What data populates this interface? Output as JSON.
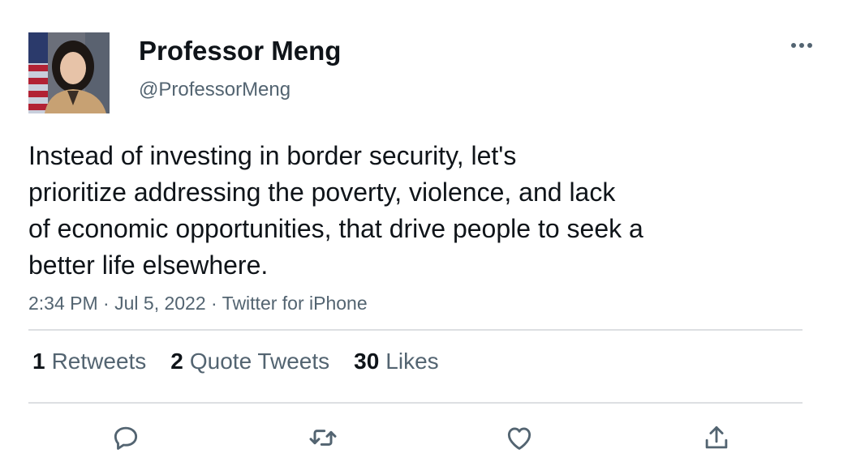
{
  "author": {
    "name": "Professor Meng",
    "handle": "@ProfessorMeng",
    "avatar_icon": "profile-photo"
  },
  "tweet": {
    "lines": [
      "Instead of investing in border security, let's",
      "prioritize addressing the poverty, violence, and lack",
      "of economic opportunities, that drive people to seek a",
      "better life elsewhere."
    ],
    "time": "2:34 PM",
    "date": "Jul 5, 2022",
    "source": "Twitter for iPhone",
    "separator": " · "
  },
  "stats": [
    {
      "count": "1",
      "label": "Retweets"
    },
    {
      "count": "2",
      "label": "Quote Tweets"
    },
    {
      "count": "30",
      "label": "Likes"
    }
  ],
  "actions": [
    "reply-icon",
    "retweet-icon",
    "like-icon",
    "share-icon"
  ],
  "colors": {
    "text": "#0f1419",
    "secondary": "#536471",
    "divider": "#dddfe2"
  }
}
